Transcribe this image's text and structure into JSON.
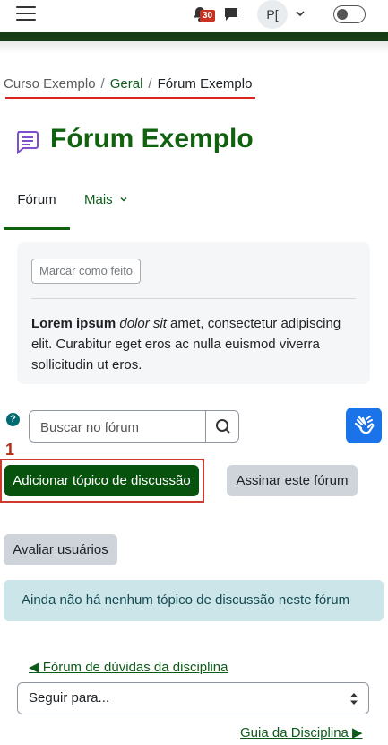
{
  "navbar": {
    "notifications_count": "30",
    "avatar_initials": "P["
  },
  "breadcrumb": {
    "items": [
      "Curso Exemplo",
      "Geral",
      "Fórum Exemplo"
    ],
    "separator": "/"
  },
  "page": {
    "title": "Fórum Exemplo",
    "title_icon": "forum-icon"
  },
  "tabs": [
    {
      "label": "Fórum",
      "active": true
    },
    {
      "label": "Mais",
      "active": false
    }
  ],
  "card": {
    "mark_done_label": "Marcar como feito",
    "description_bold": "Lorem ipsum",
    "description_italic": "dolor sit",
    "description_rest": " amet, consectetur adipiscing elit. Curabitur eget eros ac nulla euismod viverra sollicitudin ut eros."
  },
  "search": {
    "help_icon": "?",
    "placeholder": "Buscar no fórum"
  },
  "annotation": {
    "number": "1"
  },
  "actions": {
    "add_topic_label": "Adicionar tópico de discussão",
    "subscribe_label": "Assinar este fórum",
    "rate_users_label": "Avaliar usuários"
  },
  "alert": {
    "text": "Ainda não há nenhum tópico de discussão neste fórum"
  },
  "navigation": {
    "prev_link": "◀ Fórum de dúvidas da disciplina",
    "jump_select": "Seguir para...",
    "next_link": "Guia da Disciplina ▶"
  },
  "colors": {
    "brand_green": "#10620f",
    "primary_button": "#07520c",
    "annotation_red": "#d03a2e",
    "accessibility_blue": "#1a73e8",
    "info_alert_bg": "#cce5e8"
  }
}
